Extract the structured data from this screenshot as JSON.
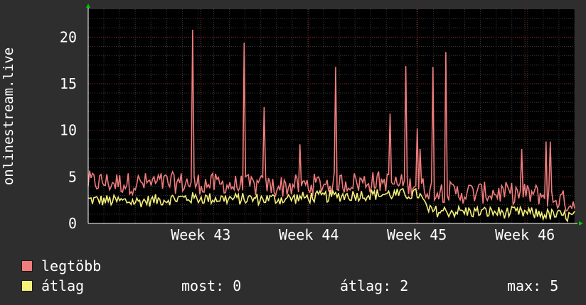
{
  "colors": {
    "background": "#2e2e2e",
    "plot_background": "#000000",
    "grid_major": "#9b2b2b",
    "grid_minor": "#3a3a3a",
    "max_series": "#f07c7c",
    "avg_series": "#f5f07a",
    "axis_arrow": "#00c800",
    "text": "#ffffff"
  },
  "chart_data": {
    "type": "line",
    "ylabel": "onlinestream.live",
    "xlabel": "",
    "title": "",
    "ylim": [
      0,
      23
    ],
    "yticks": [
      0,
      5,
      10,
      15,
      20
    ],
    "xticks": [
      {
        "label": "Week 43",
        "t": 0.2315
      },
      {
        "label": "Week 44",
        "t": 0.4536
      },
      {
        "label": "Week 45",
        "t": 0.6757
      },
      {
        "label": "Week 46",
        "t": 0.8978
      }
    ],
    "grid": true,
    "legend_placement": "bottom-left",
    "series": [
      {
        "name": "legtöbb",
        "color": "#f07c7c",
        "baseline": {
          "t": [
            0.0,
            0.1,
            0.2,
            0.3,
            0.4,
            0.5,
            0.6,
            0.67,
            0.75,
            0.85,
            0.93,
            1.0
          ],
          "v": [
            4.0,
            3.8,
            3.9,
            3.6,
            3.5,
            3.8,
            4.0,
            3.5,
            2.8,
            2.8,
            2.6,
            1.6
          ]
        },
        "spikes": [
          {
            "t": 0.216,
            "v": 20.8
          },
          {
            "t": 0.322,
            "v": 19.4
          },
          {
            "t": 0.361,
            "v": 12.5
          },
          {
            "t": 0.434,
            "v": 8.5
          },
          {
            "t": 0.51,
            "v": 16.8
          },
          {
            "t": 0.622,
            "v": 11.8
          },
          {
            "t": 0.654,
            "v": 16.9
          },
          {
            "t": 0.677,
            "v": 10.2
          },
          {
            "t": 0.71,
            "v": 16.8
          },
          {
            "t": 0.736,
            "v": 18.4
          },
          {
            "t": 0.682,
            "v": 8.0
          },
          {
            "t": 0.94,
            "v": 8.8
          },
          {
            "t": 0.95,
            "v": 8.8
          },
          {
            "t": 0.89,
            "v": 8.0
          }
        ]
      },
      {
        "name": "átlag",
        "color": "#f5f07a",
        "baseline": {
          "t": [
            0.0,
            0.1,
            0.2,
            0.3,
            0.4,
            0.5,
            0.6,
            0.68,
            0.7,
            0.8,
            0.9,
            1.0
          ],
          "v": [
            2.4,
            2.2,
            2.6,
            2.5,
            2.5,
            2.8,
            3.0,
            3.0,
            1.2,
            1.1,
            1.0,
            0.6
          ]
        }
      }
    ]
  },
  "legend": {
    "items": [
      {
        "label": "legtöbb",
        "color": "#f07c7c"
      },
      {
        "label": "átlag",
        "color": "#f5f07a"
      }
    ],
    "stats": {
      "most": "most: 0",
      "atlag": "átlag: 2",
      "max": "max: 5"
    }
  }
}
